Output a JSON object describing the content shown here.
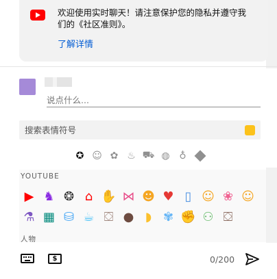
{
  "welcome": {
    "message": "欢迎使用实时聊天！请注意保护您的隐私并遵守我们的《社区准则》。",
    "learn_more": "了解详情"
  },
  "composer": {
    "placeholder": "说点什么...",
    "char_count": "0/200"
  },
  "emoji_picker": {
    "search_placeholder": "搜索表情符号",
    "skin_tone_color": "#fcc21b",
    "category_tabs": [
      {
        "icon": "youtube-star-icon",
        "glyph": "✪",
        "active": true
      },
      {
        "icon": "smiley-icon",
        "glyph": "☺"
      },
      {
        "icon": "animal-icon",
        "glyph": "✿"
      },
      {
        "icon": "cake-icon",
        "glyph": "♨"
      },
      {
        "icon": "car-icon",
        "glyph": "⛟"
      },
      {
        "icon": "basketball-icon",
        "glyph": "◍"
      },
      {
        "icon": "lightbulb-icon",
        "glyph": "♁"
      },
      {
        "icon": "diamond-icon",
        "glyph": ""
      }
    ],
    "sections": [
      {
        "label": "YOUTUBE",
        "emojis": [
          {
            "name": "yt-logo",
            "glyph": "▶",
            "color": "#ff0000"
          },
          {
            "name": "dancing-monkey",
            "glyph": "♞",
            "color": "#8a2be2"
          },
          {
            "name": "loading-circle",
            "glyph": "❂",
            "color": "#333333"
          },
          {
            "name": "yt-home",
            "glyph": "⌂",
            "color": "#ff0000"
          },
          {
            "name": "stop-hand",
            "glyph": "✋",
            "color": "#cc0000"
          },
          {
            "name": "bow-tie",
            "glyph": "⋈",
            "color": "#e84e8a"
          },
          {
            "name": "happy-face",
            "glyph": "☻",
            "color": "#f5a623"
          },
          {
            "name": "heart-plus",
            "glyph": "♥",
            "color": "#e53935"
          },
          {
            "name": "phone-hand",
            "glyph": "▯",
            "color": "#4a90e2"
          },
          {
            "name": "hug-face",
            "glyph": "☺",
            "color": "#f5a623"
          },
          {
            "name": "sparkle-face",
            "glyph": "❀",
            "color": "#f06292"
          },
          {
            "name": "hand-wave-face",
            "glyph": "☺",
            "color": "#f5a623"
          },
          {
            "name": "pill-bottle",
            "glyph": "⚗",
            "color": "#7e57c2"
          },
          {
            "name": "takeout-box",
            "glyph": "▦",
            "color": "#00897b"
          },
          {
            "name": "milk-carton",
            "glyph": "⛁",
            "color": "#42a5f5"
          },
          {
            "name": "drink-cup",
            "glyph": "☕",
            "color": "#4fc3f7"
          },
          {
            "name": "cat-box",
            "glyph": "⛋",
            "color": "#a1887f"
          },
          {
            "name": "cat-loaf",
            "glyph": "●",
            "color": "#6d4c41"
          },
          {
            "name": "yellow-blob",
            "glyph": "◗",
            "color": "#fbc02d"
          },
          {
            "name": "lotus-face",
            "glyph": "✾",
            "color": "#64b5f6"
          },
          {
            "name": "clap-hand",
            "glyph": "✊",
            "color": "#f9a825"
          },
          {
            "name": "friends",
            "glyph": "⚇",
            "color": "#66bb6a"
          },
          {
            "name": "box-couple",
            "glyph": "⛋",
            "color": "#8d6e63"
          }
        ]
      },
      {
        "label": "人物"
      }
    ]
  },
  "bottom_bar": {
    "superchat_glyph": "$"
  }
}
